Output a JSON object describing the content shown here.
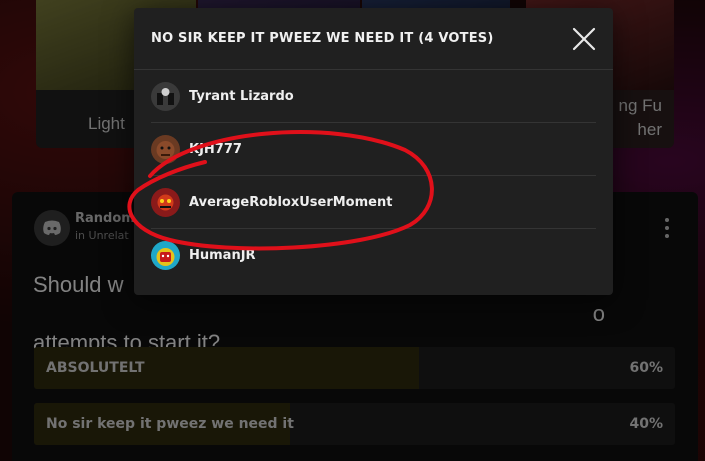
{
  "background_cards": [
    {
      "label": "Light"
    },
    {
      "label": ""
    },
    {
      "label": ""
    },
    {
      "label_line1": "ng Fu",
      "label_line2": "her"
    }
  ],
  "poll": {
    "author": "Random",
    "subtitle": "in Unrelat",
    "question_line1": "Should w",
    "question_hidden_tail": "o",
    "question_line2": "attempts to start it?",
    "options": [
      {
        "label": "ABSOLUTELT",
        "percent_text": "60%",
        "percent": 60
      },
      {
        "label": "No sir keep it pweez we need it",
        "percent_text": "40%",
        "percent": 40
      }
    ],
    "author_icon": "discord-icon",
    "more_icon": "more-vertical-icon"
  },
  "modal": {
    "title": "NO SIR KEEP IT PWEEZ WE NEED IT (4 VOTES)",
    "close_icon": "close-icon",
    "voters": [
      {
        "name": "Tyrant Lizardo"
      },
      {
        "name": "KJH777"
      },
      {
        "name": "AverageRobloxUserMoment"
      },
      {
        "name": "HumanJR"
      }
    ]
  },
  "colors": {
    "modal_bg": "#202020",
    "option_fill": "#2f2a0e",
    "annotation_red": "#e0101a"
  }
}
